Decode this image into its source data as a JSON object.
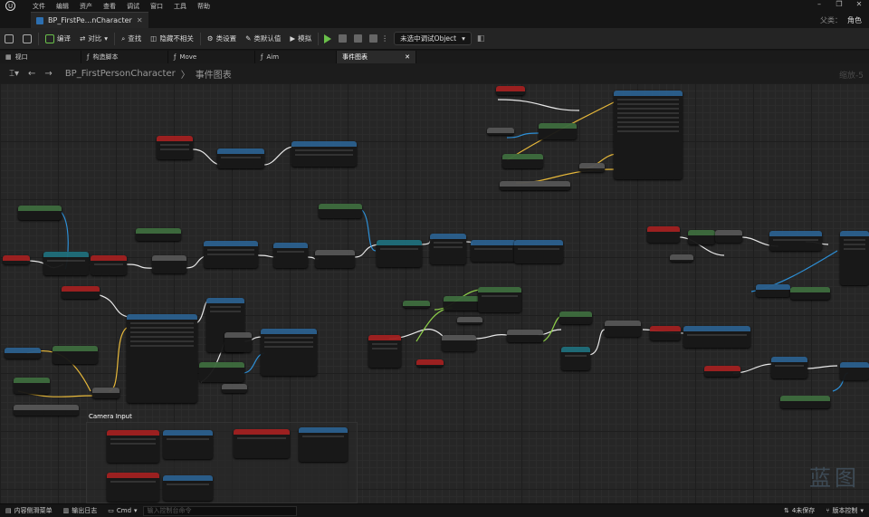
{
  "menu": {
    "items": [
      "文件",
      "编辑",
      "资产",
      "查看",
      "调试",
      "窗口",
      "工具",
      "帮助"
    ]
  },
  "document": {
    "tab_title": "BP_FirstPe...nCharacter",
    "parent_label": "父类：",
    "parent_value": "角色"
  },
  "toolbar": {
    "compile": "编译",
    "diff": "对比",
    "find": "查找",
    "hide_unrelated": "隐藏不相关",
    "class_settings": "类设置",
    "class_defaults": "类默认值",
    "simulate": "模拟",
    "debug_object": "未选中调试Object"
  },
  "tabs": [
    {
      "label": "视口",
      "active": false
    },
    {
      "label": "构造脚本",
      "active": false
    },
    {
      "label": "Move",
      "active": false
    },
    {
      "label": "Aim",
      "active": false
    },
    {
      "label": "事件图表",
      "active": true
    }
  ],
  "breadcrumb": {
    "root": "BP_FirstPersonCharacter",
    "separator": "〉",
    "current": "事件图表"
  },
  "graph": {
    "zoom": "缩放-5",
    "comment_title": "Camera Input"
  },
  "watermark": "蓝图",
  "status": {
    "content_drawer": "内容侧滑菜单",
    "output_log": "输出日志",
    "cmd": "Cmd",
    "cmd_placeholder": "输入控制台命令",
    "unsaved": "4未保存",
    "source_control": "版本控制"
  },
  "colors": {
    "exec_wire": "#e8e8e8",
    "object_wire": "#2d8fd6",
    "float_wire": "#8fd14a",
    "struct_wire": "#e8b93a",
    "event_header": "#a02020"
  }
}
